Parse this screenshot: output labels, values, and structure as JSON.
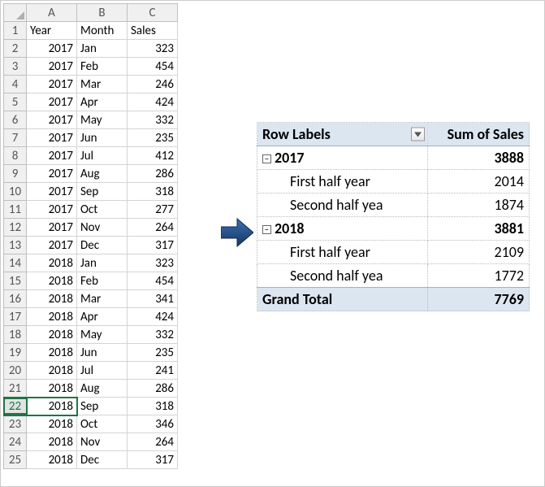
{
  "sheet": {
    "columns": [
      "A",
      "B",
      "C"
    ],
    "headers": [
      "Year",
      "Month",
      "Sales"
    ],
    "rows": [
      {
        "n": 1
      },
      {
        "n": 2,
        "a": "2017",
        "b": "Jan",
        "c": "323"
      },
      {
        "n": 3,
        "a": "2017",
        "b": "Feb",
        "c": "454"
      },
      {
        "n": 4,
        "a": "2017",
        "b": "Mar",
        "c": "246"
      },
      {
        "n": 5,
        "a": "2017",
        "b": "Apr",
        "c": "424"
      },
      {
        "n": 6,
        "a": "2017",
        "b": "May",
        "c": "332"
      },
      {
        "n": 7,
        "a": "2017",
        "b": "Jun",
        "c": "235"
      },
      {
        "n": 8,
        "a": "2017",
        "b": "Jul",
        "c": "412"
      },
      {
        "n": 9,
        "a": "2017",
        "b": "Aug",
        "c": "286"
      },
      {
        "n": 10,
        "a": "2017",
        "b": "Sep",
        "c": "318"
      },
      {
        "n": 11,
        "a": "2017",
        "b": "Oct",
        "c": "277"
      },
      {
        "n": 12,
        "a": "2017",
        "b": "Nov",
        "c": "264"
      },
      {
        "n": 13,
        "a": "2017",
        "b": "Dec",
        "c": "317"
      },
      {
        "n": 14,
        "a": "2018",
        "b": "Jan",
        "c": "323"
      },
      {
        "n": 15,
        "a": "2018",
        "b": "Feb",
        "c": "454"
      },
      {
        "n": 16,
        "a": "2018",
        "b": "Mar",
        "c": "341"
      },
      {
        "n": 17,
        "a": "2018",
        "b": "Apr",
        "c": "424"
      },
      {
        "n": 18,
        "a": "2018",
        "b": "May",
        "c": "332"
      },
      {
        "n": 19,
        "a": "2018",
        "b": "Jun",
        "c": "235"
      },
      {
        "n": 20,
        "a": "2018",
        "b": "Jul",
        "c": "241"
      },
      {
        "n": 21,
        "a": "2018",
        "b": "Aug",
        "c": "286"
      },
      {
        "n": 22,
        "a": "2018",
        "b": "Sep",
        "c": "318"
      },
      {
        "n": 23,
        "a": "2018",
        "b": "Oct",
        "c": "346"
      },
      {
        "n": 24,
        "a": "2018",
        "b": "Nov",
        "c": "264"
      },
      {
        "n": 25,
        "a": "2018",
        "b": "Dec",
        "c": "317"
      }
    ],
    "selected_row": 22
  },
  "pivot": {
    "row_labels": "Row Labels",
    "sum_header": "Sum of Sales",
    "collapse_glyph": "−",
    "groups": [
      {
        "year": "2017",
        "total": "3888",
        "items": [
          {
            "label": "First half year",
            "val": "2014"
          },
          {
            "label": "Second half yea",
            "val": "1874"
          }
        ]
      },
      {
        "year": "2018",
        "total": "3881",
        "items": [
          {
            "label": "First half year",
            "val": "2109"
          },
          {
            "label": "Second half yea",
            "val": "1772"
          }
        ]
      }
    ],
    "grand_label": "Grand Total",
    "grand_total": "7769"
  }
}
